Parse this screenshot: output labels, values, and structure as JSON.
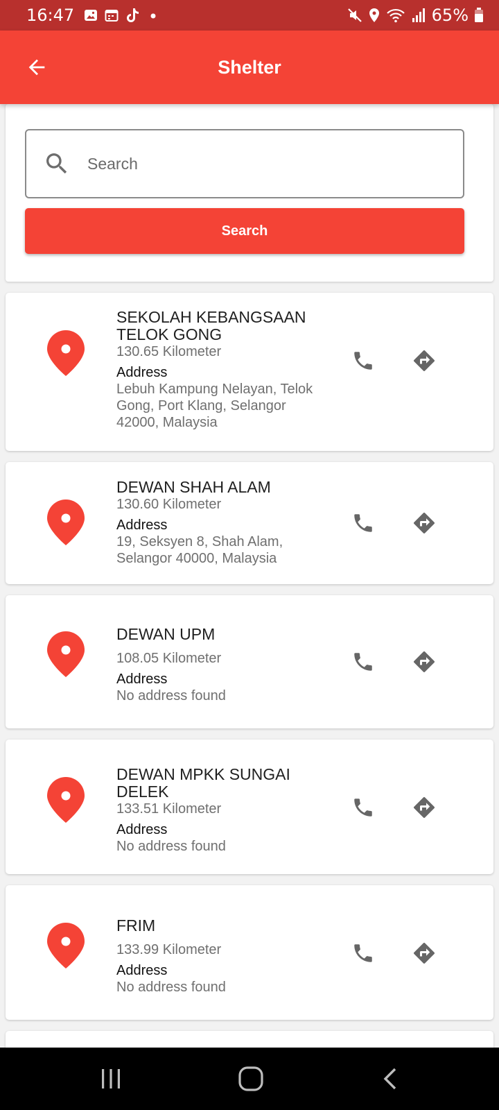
{
  "status_bar": {
    "time": "16:47",
    "battery": "65%",
    "icons_left": [
      "gallery-icon",
      "calendar-icon",
      "tiktok-icon",
      "dot-icon"
    ],
    "icons_right": [
      "mute-icon",
      "location-icon",
      "wifi-icon",
      "signal-icon",
      "battery-icon"
    ]
  },
  "app_bar": {
    "title": "Shelter"
  },
  "search": {
    "placeholder": "Search",
    "button_label": "Search"
  },
  "colors": {
    "accent": "#f44336",
    "status_bar": "#b8302d",
    "nav_bar": "#000000"
  },
  "shelters": [
    {
      "name": "SEKOLAH KEBANGSAAN TELOK GONG",
      "distance": "130.65 Kilometer",
      "address_label": "Address",
      "address": "Lebuh Kampung Nelayan, Telok Gong, Port Klang, Selangor 42000, Malaysia"
    },
    {
      "name": "DEWAN SHAH ALAM",
      "distance": "130.60 Kilometer",
      "address_label": "Address",
      "address": "19, Seksyen 8, Shah Alam, Selangor 40000, Malaysia"
    },
    {
      "name": "DEWAN UPM",
      "distance": "108.05 Kilometer",
      "address_label": "Address",
      "address": "No address found"
    },
    {
      "name": "DEWAN MPKK SUNGAI DELEK",
      "distance": "133.51 Kilometer",
      "address_label": "Address",
      "address": "No address found"
    },
    {
      "name": "FRIM",
      "distance": "133.99 Kilometer",
      "address_label": "Address",
      "address": "No address found"
    }
  ]
}
